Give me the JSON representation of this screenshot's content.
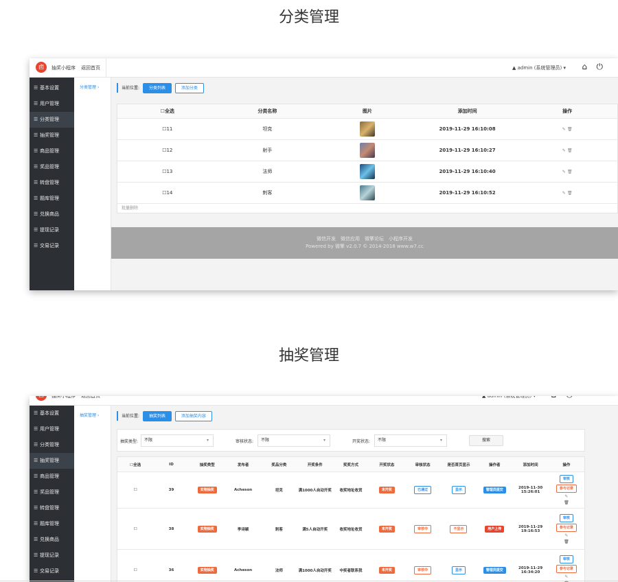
{
  "section1": {
    "title": "分类管理"
  },
  "section2": {
    "title": "抽奖管理"
  },
  "topbar": {
    "app_name": "抽奖小程序",
    "back_home": "返回首页",
    "user": "admin (系统管理员)",
    "logo_glyph": "卣"
  },
  "sidebar": {
    "items": [
      "基本设置",
      "用户管理",
      "分类管理",
      "抽奖管理",
      "商品管理",
      "奖品管理",
      "转盘管理",
      "题库管理",
      "兑换商品",
      "提现记录",
      "交易记录"
    ]
  },
  "shot1": {
    "sub_menu": "分类管理 ›",
    "crumb_label": "当前位置:",
    "tab_active": "分类列表",
    "tab_other": "添加分类",
    "table": {
      "headers": [
        "全选",
        "分类名称",
        "图片",
        "添加时间",
        "操作"
      ],
      "rows": [
        {
          "id": "11",
          "name": "坦克",
          "time": "2019-11-29 16:10:08"
        },
        {
          "id": "12",
          "name": "射手",
          "time": "2019-11-29 16:10:27"
        },
        {
          "id": "13",
          "name": "法师",
          "time": "2019-11-29 16:10:40"
        },
        {
          "id": "14",
          "name": "刺客",
          "time": "2019-11-29 16:10:52"
        }
      ],
      "batch_delete": "批量删除"
    },
    "footer": {
      "links": "微信开发　微信应用　微擎论坛　小程序开发",
      "powered": "Powered by 微擎 v2.0.7 © 2014-2018 www.w7.cc"
    }
  },
  "shot2": {
    "sub_menu": "抽奖管理 ›",
    "crumb_label": "当前位置:",
    "tab_active": "抽奖列表",
    "tab_other": "添加抽奖内容",
    "filter": {
      "type_label": "抽奖类型:",
      "type_value": "不限",
      "review_label": "审核状态:",
      "review_value": "不限",
      "open_label": "开奖状态:",
      "open_value": "不限",
      "search": "搜索"
    },
    "table": {
      "headers": [
        "全选",
        "ID",
        "抽奖类型",
        "发布者",
        "奖品分类",
        "开奖条件",
        "奖奖方式",
        "开奖状态",
        "审核状态",
        "是否首页显示",
        "操作者",
        "添加时间",
        "操作"
      ],
      "rows": [
        {
          "id": "39",
          "type": "实物抽奖",
          "publisher": "Acheson",
          "category": "坦克",
          "condition": "满1000人自动开奖",
          "method": "收奖地址收货",
          "open": "未开奖",
          "review": "已通过",
          "home": "显示",
          "operator": "管理员提交",
          "date": "2019-11-30",
          "time": "15:26:01"
        },
        {
          "id": "38",
          "type": "实物抽奖",
          "publisher": "李诗颖",
          "category": "刺客",
          "condition": "满5人自动开奖",
          "method": "收奖地址收货",
          "open": "未开奖",
          "review": "审核中",
          "home": "不显示",
          "operator": "用户上传",
          "date": "2019-11-29",
          "time": "19:16:53"
        },
        {
          "id": "36",
          "type": "实物抽奖",
          "publisher": "Acheson",
          "category": "法师",
          "condition": "满1000人自动开奖",
          "method": "中奖者联系我",
          "open": "未开奖",
          "review": "审核中",
          "home": "显示",
          "operator": "管理员提交",
          "date": "2019-11-29",
          "time": "16:34:20"
        }
      ],
      "op_review": "审核",
      "op_record": "参与记录"
    }
  },
  "icons": {
    "user": "▲",
    "home": "⌂",
    "power": "⏻",
    "edit": "✎",
    "delete": "🗑",
    "menu": "☰"
  },
  "colors": {
    "accent": "#2b8fe8",
    "sidebar": "#2c3035",
    "orange": "#ee6a3c",
    "red": "#e8442e"
  }
}
